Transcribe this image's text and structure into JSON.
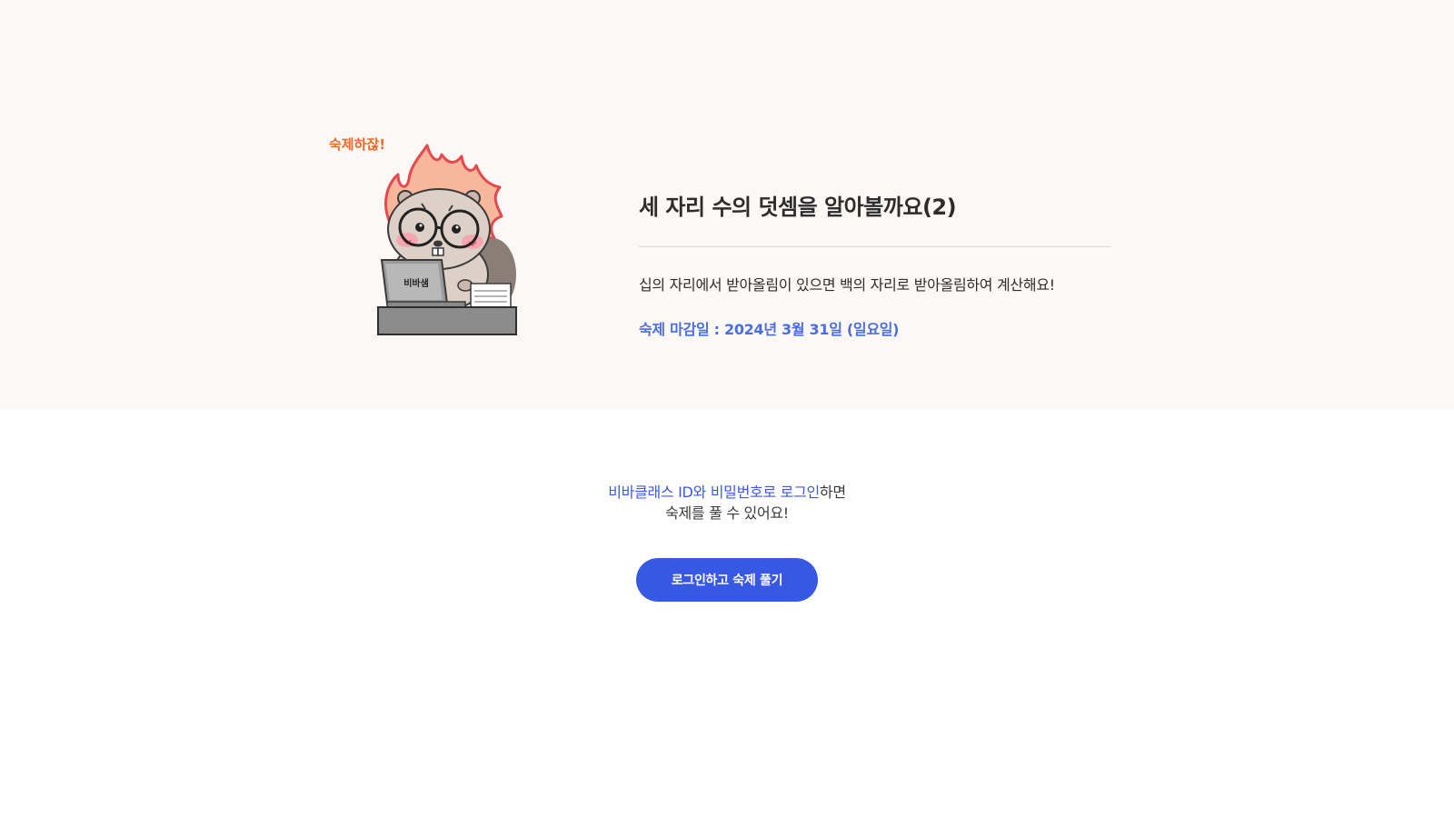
{
  "hero": {
    "mascot": {
      "bubble_text": "숙제하잖!",
      "laptop_label": "비바샘"
    },
    "title": "세 자리 수의 덧셈을 알아볼까요(2)",
    "description": "십의 자리에서 받아올림이 있으면 백의 자리로 받아올림하여 계산해요!",
    "deadline": "숙제 마감일 : 2024년 3월 31일 (일요일)"
  },
  "login": {
    "message_highlight": "비바클래스 ID와 비밀번호로 로그인",
    "message_rest_line1": "하면",
    "message_line2": "숙제를 풀 수 있어요!",
    "button_label": "로그인하고 숙제 풀기"
  },
  "colors": {
    "hero_background": "#fcf8f6",
    "accent_blue": "#3658e3",
    "deadline_blue": "#4a6ee0",
    "bubble_orange": "#f06a2c"
  }
}
